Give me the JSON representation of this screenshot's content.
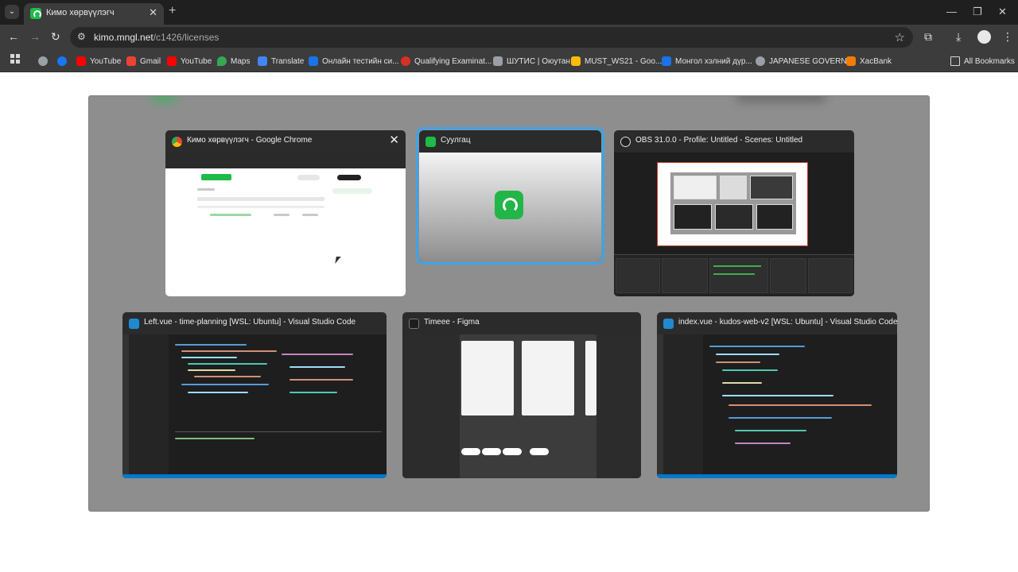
{
  "browser": {
    "tab_title": "Кимо хөрвүүлэгч",
    "url_host": "kimo.mngl.net",
    "url_path": "/c1426/licenses",
    "all_bookmarks_label": "All Bookmarks"
  },
  "bookmarks": [
    {
      "label": "YouTube",
      "color": "#ff0000"
    },
    {
      "label": "Gmail",
      "color": "#ea4335"
    },
    {
      "label": "YouTube",
      "color": "#ff0000"
    },
    {
      "label": "Maps",
      "color": "#34a853"
    },
    {
      "label": "Translate",
      "color": "#4285f4"
    },
    {
      "label": "Онлайн тестийн си...",
      "color": "#1a73e8"
    },
    {
      "label": "Qualifying Examinat...",
      "color": "#d93025"
    },
    {
      "label": "ШУТИС | Оюутан",
      "color": "#9aa0a6"
    },
    {
      "label": "MUST_WS21 - Goo...",
      "color": "#fbbc04"
    },
    {
      "label": "Монгол хэлний дүр...",
      "color": "#1a73e8"
    },
    {
      "label": "JAPANESE GOVERN...",
      "color": "#9aa0a6"
    },
    {
      "label": "XacBank",
      "color": "#f57c00"
    }
  ],
  "switcher": {
    "windows": [
      {
        "title": "Кимо хөрвүүлэгч - Google Chrome",
        "app": "chrome"
      },
      {
        "title": "Суулгац",
        "app": "suulgats",
        "selected": true
      },
      {
        "title": "OBS 31.0.0 - Profile: Untitled - Scenes: Untitled",
        "app": "obs"
      },
      {
        "title": "Left.vue - time-planning [WSL: Ubuntu] - Visual Studio Code",
        "app": "vscode"
      },
      {
        "title": "Timeee - Figma",
        "app": "figma"
      },
      {
        "title": "index.vue - kudos-web-v2 [WSL: Ubuntu] - Visual Studio Code",
        "app": "vscode"
      }
    ]
  },
  "colors": {
    "accent_selection": "#3ea4e8",
    "kimo_green": "#1dbb47"
  }
}
